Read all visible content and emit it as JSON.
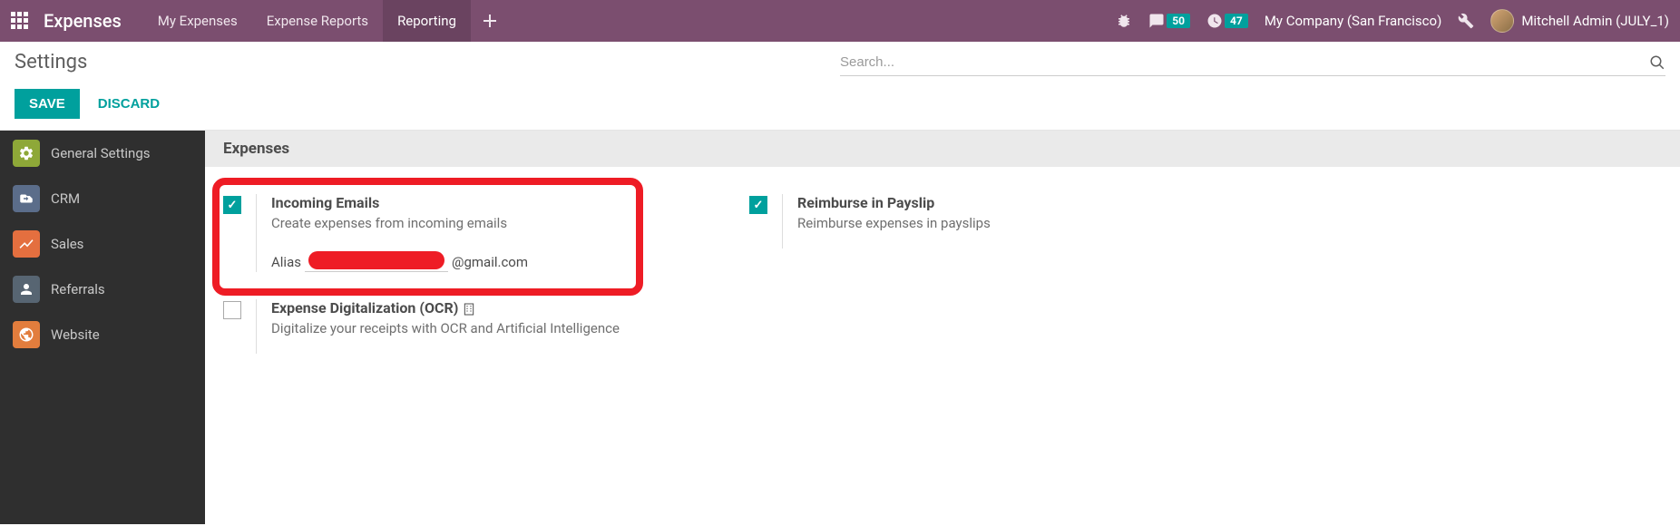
{
  "navbar": {
    "brand": "Expenses",
    "menu": [
      {
        "label": "My Expenses"
      },
      {
        "label": "Expense Reports"
      },
      {
        "label": "Reporting",
        "active": true
      }
    ],
    "messages_badge": "50",
    "activities_badge": "47",
    "company": "My Company (San Francisco)",
    "user": "Mitchell Admin (JULY_1)"
  },
  "control_panel": {
    "title": "Settings",
    "search_placeholder": "Search...",
    "save_label": "SAVE",
    "discard_label": "DISCARD"
  },
  "sidebar": {
    "items": [
      {
        "label": "General Settings"
      },
      {
        "label": "CRM"
      },
      {
        "label": "Sales"
      },
      {
        "label": "Referrals"
      },
      {
        "label": "Website"
      }
    ]
  },
  "main": {
    "section_title": "Expenses",
    "incoming_emails": {
      "title": "Incoming Emails",
      "desc": "Create expenses from incoming emails",
      "alias_label": "Alias",
      "domain": "@gmail.com"
    },
    "reimburse": {
      "title": "Reimburse in Payslip",
      "desc": "Reimburse expenses in payslips"
    },
    "ocr": {
      "title": "Expense Digitalization (OCR)",
      "desc": "Digitalize your receipts with OCR and Artificial Intelligence"
    }
  }
}
